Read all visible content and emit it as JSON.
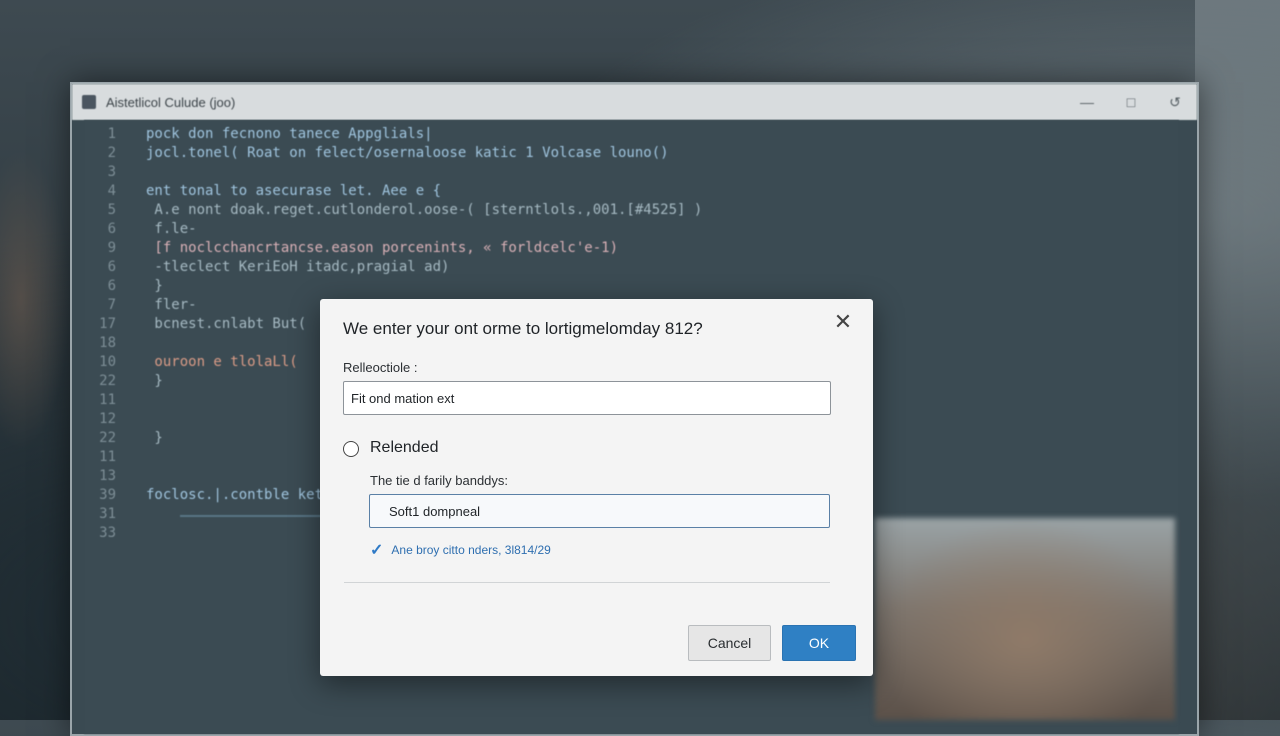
{
  "window": {
    "title": "Aistetlicol Culude (joo)",
    "controls": [
      "minimize-icon",
      "maximize-icon",
      "restore-icon"
    ]
  },
  "editor": {
    "lines": [
      {
        "num": "1",
        "text": "pock don fecnono tanece Appglials|"
      },
      {
        "num": "2",
        "text": "jocl.tonel( Roat on felect/osernaloose katic 1  Volcase louno()"
      },
      {
        "num": "3",
        "text": ""
      },
      {
        "num": "4",
        "text": "ent tonal to asecurase let. Aee e {"
      },
      {
        "num": "5",
        "text": "  A.e nont doak.reget.cutlonderol.oose-( [sterntlols.,001.[#4525] )"
      },
      {
        "num": "6",
        "text": "  f.le-"
      },
      {
        "num": "9",
        "text": "  [f noclcchancrtancse.eason porcenints, « forldcelc'e-1)"
      },
      {
        "num": "6",
        "text": "     -tleclect KeriEoH itadc,pragial ad)"
      },
      {
        "num": "6",
        "text": "  }"
      },
      {
        "num": "7",
        "text": "  fler-"
      },
      {
        "num": "17",
        "text": "  bcnest.cnlabt But("
      },
      {
        "num": "18",
        "text": ""
      },
      {
        "num": "10",
        "text": "  ouroon e tlolaLl("
      },
      {
        "num": "22",
        "text": "  }"
      },
      {
        "num": "11",
        "text": ""
      },
      {
        "num": "12",
        "text": ""
      },
      {
        "num": "22",
        "text": "  }"
      },
      {
        "num": "11",
        "text": ""
      },
      {
        "num": "13",
        "text": ""
      },
      {
        "num": "39",
        "text": "foclosc.|.contble ket"
      },
      {
        "num": "31",
        "text": ""
      },
      {
        "num": "33",
        "text": ""
      }
    ]
  },
  "dialog": {
    "title": "We enter your ont orme to lortigmelomday 812?",
    "field1_label": "Relleoctiole :",
    "field1_value": "Fit ond mation ext",
    "radio_label": "Relended",
    "field2_label": "The tie d farily banddys:",
    "field2_value": "Soft1 dompneal",
    "hint_text": "Ane broy citto nders, 3l814/29",
    "cancel_label": "Cancel",
    "ok_label": "OK",
    "accent_color": "#2f80c4"
  }
}
